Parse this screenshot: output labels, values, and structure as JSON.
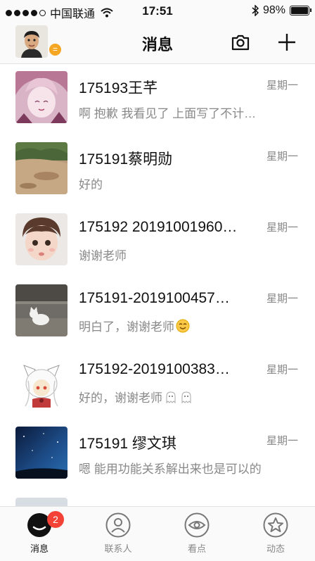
{
  "status_bar": {
    "carrier": "中国联通",
    "time": "17:51",
    "battery": "98%",
    "battery_level": 0.98
  },
  "nav": {
    "title": "消息",
    "badge": "="
  },
  "chats": [
    {
      "name": "175193王芊",
      "time": "星期一",
      "preview": "啊 抱歉 我看见了 上面写了不计…",
      "avatar": "anime-girl-avatar"
    },
    {
      "name": "175191蔡明勋",
      "time": "星期一",
      "preview": "好的",
      "avatar": "rock-landscape-avatar"
    },
    {
      "name": "175192  20191001960…",
      "time": "星期一",
      "preview": "谢谢老师",
      "avatar": "child-photo-avatar"
    },
    {
      "name": "175191-2019100457…",
      "time": "星期一",
      "preview": "明白了，谢谢老师",
      "avatar": "white-cat-avatar"
    },
    {
      "name": "175192-2019100383…",
      "time": "星期一",
      "preview": "好的，谢谢老师",
      "avatar": "anime-cat-girl-avatar"
    },
    {
      "name": "175191 缪文琪",
      "time": "星期一",
      "preview": "嗯 能用功能关系解出来也是可以的",
      "avatar": "night-sky-avatar"
    }
  ],
  "tabs": [
    {
      "label": "消息",
      "icon": "message-bubble-icon",
      "badge": "2"
    },
    {
      "label": "联系人",
      "icon": "contact-person-icon"
    },
    {
      "label": "看点",
      "icon": "eye-icon"
    },
    {
      "label": "动态",
      "icon": "star-circle-icon"
    }
  ],
  "colors": {
    "badge_red": "#f44336",
    "badge_orange": "#f5a623",
    "secondary_text": "#888888"
  }
}
